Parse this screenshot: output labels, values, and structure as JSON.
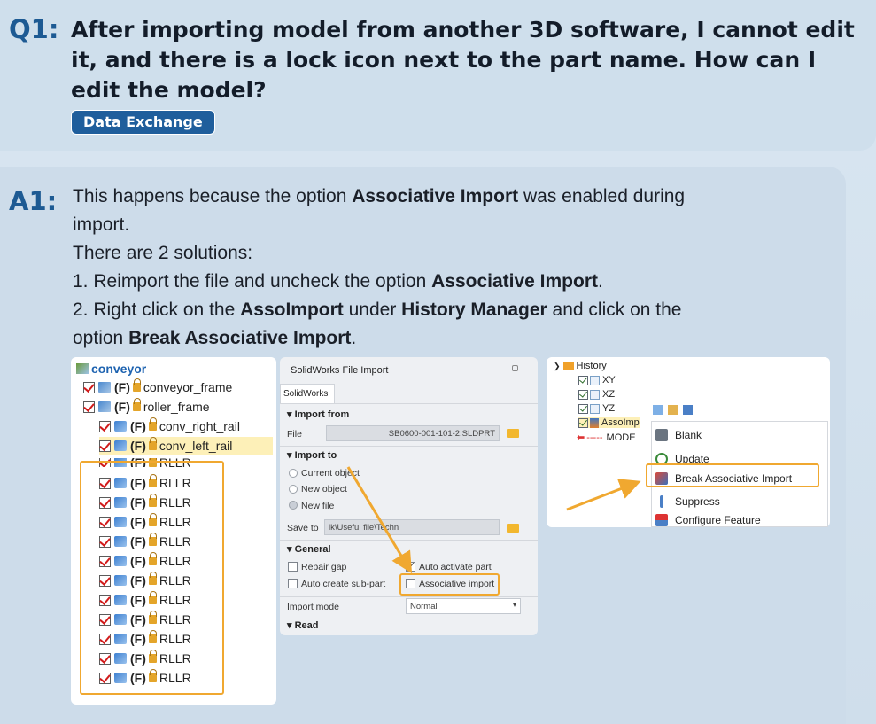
{
  "question": {
    "label": "Q1:",
    "text": "After importing model from another 3D software, I cannot edit it, and there is a lock icon next to the part name. How can I edit the model?",
    "tag": "Data Exchange"
  },
  "answer": {
    "label": "A1:",
    "line1_pre": "This happens because the option ",
    "line1_bold": "Associative Import",
    "line1_post": " was enabled during",
    "line2": "import.",
    "line3": "There are 2 solutions:",
    "line4_pre": "1. Reimport the file and uncheck the option ",
    "line4_bold": "Associative Import",
    "line4_post": ".",
    "line5_pre": "2. Right click on the ",
    "line5_bold1": "AssoImport",
    "line5_mid": " under ",
    "line5_bold2": "History Manager",
    "line5_post": " and click on the",
    "line6_pre": "option ",
    "line6_bold": "Break Associative Import",
    "line6_post": "."
  },
  "tree": {
    "root": "conveyor",
    "flag": "(F)",
    "items": [
      "conveyor_frame",
      "roller_frame",
      "conv_right_rail",
      "conv_left_rail",
      "RLLR"
    ]
  },
  "import_dialog": {
    "title": "SolidWorks File Import",
    "tab": "SolidWorks",
    "import_from": "Import from",
    "file_label": "File",
    "file_value": "SB0600-001-101-2.SLDPRT",
    "import_to": "Import to",
    "opt_current": "Current object",
    "opt_new_object": "New object",
    "opt_new_file": "New file",
    "save_to_label": "Save to",
    "save_to_value": "ik\\Useful file\\Techn",
    "general": "General",
    "repair_gap": "Repair gap",
    "auto_activate": "Auto activate part",
    "auto_sub": "Auto create sub-part",
    "assoc_import": "Associative import",
    "import_mode_label": "Import mode",
    "import_mode_value": "Normal",
    "read": "Read"
  },
  "history": {
    "title": "History",
    "planes": [
      "XY",
      "XZ",
      "YZ"
    ],
    "asso_item": "AssoImp",
    "mode_item": "MODE"
  },
  "context_menu": {
    "items": [
      "Blank",
      "Update",
      "Break Associative Import",
      "Suppress",
      "Configure Feature"
    ]
  },
  "colors": {
    "accent_blue": "#1d5a93",
    "highlight_orange": "#f0a830"
  }
}
